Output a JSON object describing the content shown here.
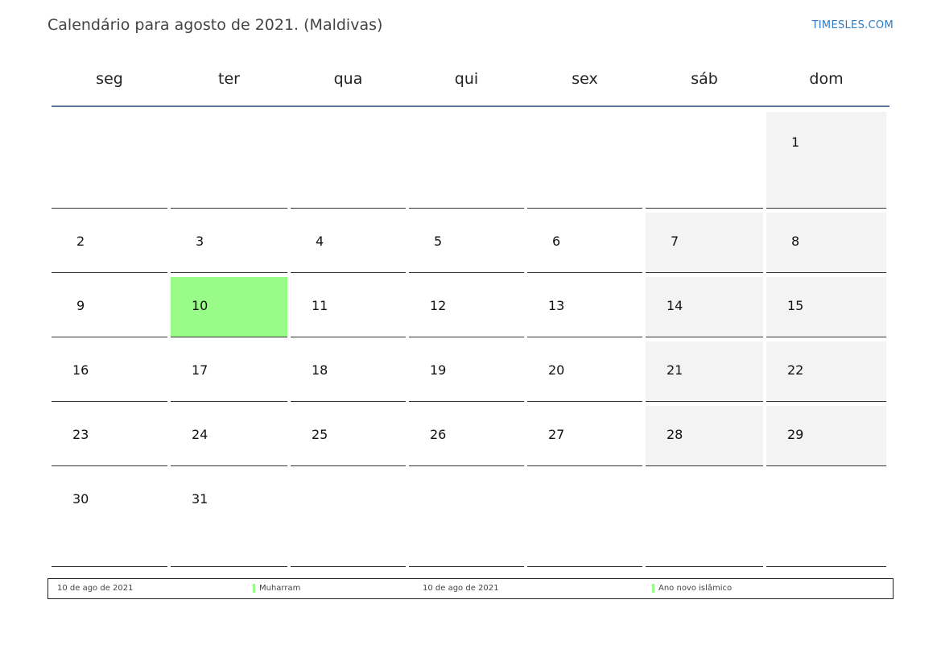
{
  "header": {
    "title": "Calendário para agosto de 2021. (Maldivas)",
    "brand": "TIMESLES.COM"
  },
  "calendar": {
    "weekdays": [
      "seg",
      "ter",
      "qua",
      "qui",
      "sex",
      "sáb",
      "dom"
    ],
    "weeks": [
      [
        "",
        "",
        "",
        "",
        "",
        "",
        "1"
      ],
      [
        "2",
        "3",
        "4",
        "5",
        "6",
        "7",
        "8"
      ],
      [
        "9",
        "10",
        "11",
        "12",
        "13",
        "14",
        "15"
      ],
      [
        "16",
        "17",
        "18",
        "19",
        "20",
        "21",
        "22"
      ],
      [
        "23",
        "24",
        "25",
        "26",
        "27",
        "28",
        "29"
      ],
      [
        "30",
        "31",
        "",
        "",
        "",
        "",
        ""
      ]
    ],
    "highlighted_day": "10",
    "highlight_color": "#99fb88",
    "weekend_color": "#f3f3f3",
    "header_rule_color": "#587693"
  },
  "legend": {
    "entries": [
      {
        "date": "10 de ago de 2021",
        "name": "Muharram",
        "color": "#99fb88"
      },
      {
        "date": "10 de ago de 2021",
        "name": "Ano novo islâmico",
        "color": "#99fb88"
      }
    ]
  }
}
